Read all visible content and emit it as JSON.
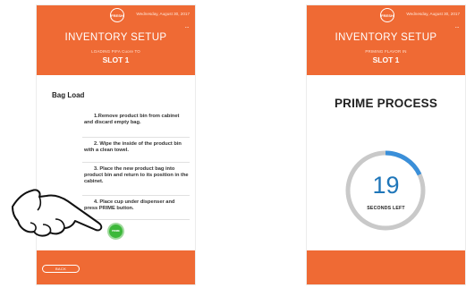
{
  "screens": {
    "left": {
      "date": "Wednesday, August 30, 2017",
      "menu": "...",
      "title": "INVENTORY SETUP",
      "subtitle": "LOADING PIFA Cuore TO",
      "slot": "SLOT 1",
      "bag_load_title": "Bag Load",
      "steps": [
        "1.Remove product bin from cabinet and discard empty bag.",
        "2. Wipe the inside of the product bin with a clean towel.",
        "3. Place the new product bag into product bin and return to its position in the cabinet.",
        "4. Place cup under dispenser and press PRIME button."
      ],
      "prime_button": "PRIME",
      "back_button": "BACK"
    },
    "right": {
      "date": "Wednesday, August 30, 2017",
      "menu": "...",
      "title": "INVENTORY SETUP",
      "subtitle": "PRIMING FLAVOR IN",
      "slot": "SLOT 1",
      "prime_title": "PRIME PROCESS",
      "timer_value": "19",
      "timer_label": "SECONDS LEFT",
      "timer_progress_fraction": 0.18
    }
  },
  "logo_text": "FRESH",
  "colors": {
    "brand_orange": "#ef6a34",
    "timer_blue": "#3a8fd9",
    "timer_track": "#c9c9c9",
    "prime_green": "#3cb83a"
  }
}
